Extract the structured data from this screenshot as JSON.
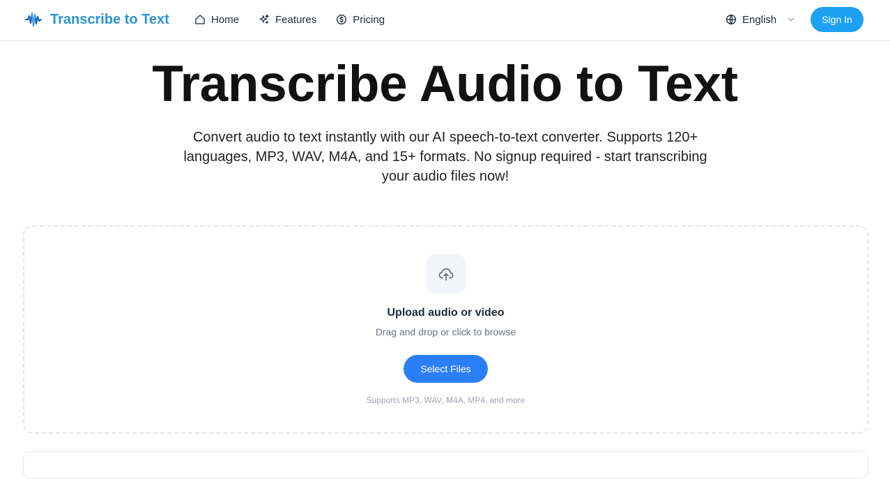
{
  "header": {
    "brand": "Transcribe to Text",
    "nav": [
      {
        "label": "Home",
        "icon": "home-icon"
      },
      {
        "label": "Features",
        "icon": "sparkles-icon"
      },
      {
        "label": "Pricing",
        "icon": "dollar-circle-icon"
      }
    ],
    "language": "English",
    "sign_in": "Sign In"
  },
  "hero": {
    "title": "Transcribe Audio to Text",
    "subtitle": "Convert audio to text instantly with our AI speech-to-text converter. Supports 120+ languages, MP3, WAV, M4A, and 15+ formats. No signup required - start transcribing your audio files now!"
  },
  "upload": {
    "icon": "upload-cloud-icon",
    "title": "Upload audio or video",
    "description": "Drag and drop or click to browse",
    "button": "Select Files",
    "formats_note": "Supports MP3, WAV, M4A, MP4, and more"
  },
  "colors": {
    "brand": "#2b93d8",
    "sign_in_button": "#1da1f2",
    "primary_button": "#2b7ff6"
  }
}
